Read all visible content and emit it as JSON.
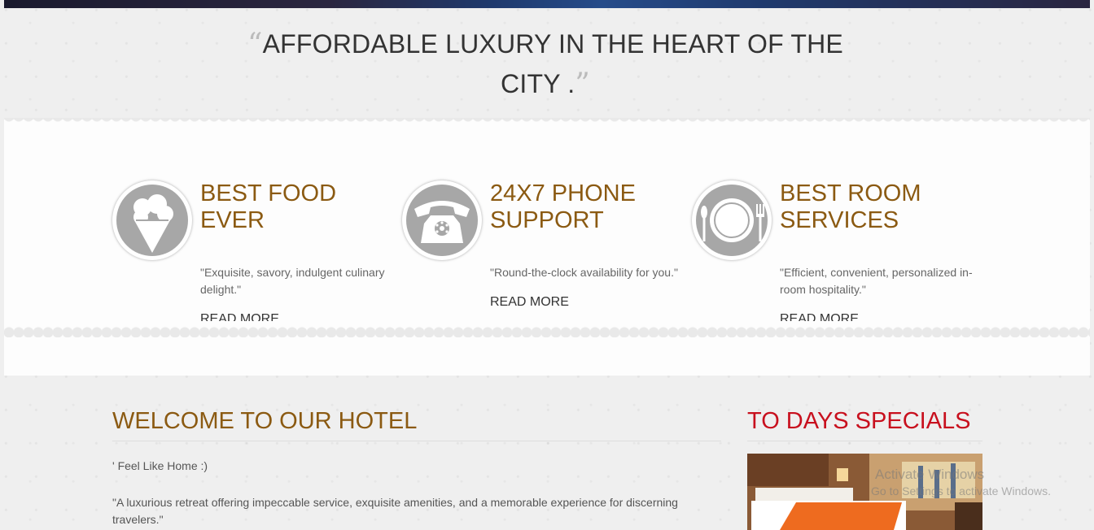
{
  "tagline": {
    "open_quote": "“",
    "text": "AFFORDABLE LUXURY IN THE HEART OF THE CITY .",
    "close_quote": "”"
  },
  "features": [
    {
      "icon": "ice-cream-icon",
      "title": "BEST FOOD EVER",
      "description": "\"Exquisite, savory, indulgent culinary delight.\"",
      "link": "READ MORE"
    },
    {
      "icon": "telephone-icon",
      "title": "24X7 PHONE SUPPORT",
      "description": "\"Round-the-clock availability for you.\"",
      "link": "READ MORE"
    },
    {
      "icon": "plate-cutlery-icon",
      "title": "BEST ROOM SERVICES",
      "description": "\"Efficient, convenient, personalized in-room hospitality.\"",
      "link": "READ MORE"
    }
  ],
  "welcome": {
    "title": "WELCOME TO OUR HOTEL",
    "subtitle": "' Feel Like Home :)",
    "body": "\"A luxurious retreat offering impeccable service, exquisite amenities, and a memorable experience for discerning travelers.\""
  },
  "specials": {
    "title": "TO DAYS SPECIALS",
    "image": "hotel-room-photo"
  },
  "watermark": {
    "line1": "Activate Windows",
    "line2": "Go to Settings to activate Windows."
  },
  "colors": {
    "accent_brown": "#8b5a12",
    "accent_red": "#c8101e",
    "icon_gray": "#a7a7a7"
  }
}
